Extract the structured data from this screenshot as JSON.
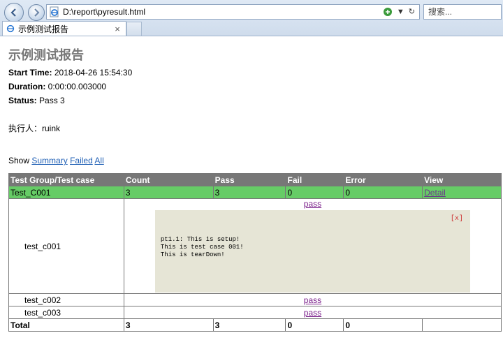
{
  "browser": {
    "address": "D:\\report\\pyresult.html",
    "search_placeholder": "搜索...",
    "tab_title": "示例测试报告",
    "tab_close": "×",
    "addr_dropdown": "▼",
    "addr_refresh": "↻"
  },
  "report": {
    "title": "示例测试报告",
    "start_time_label": "Start Time:",
    "start_time_value": "2018-04-26 15:54:30",
    "duration_label": "Duration:",
    "duration_value": "0:00:00.003000",
    "status_label": "Status:",
    "status_value": "Pass 3",
    "executor": "执行人：ruink",
    "show_label": "Show",
    "filter_summary": "Summary",
    "filter_failed": "Failed",
    "filter_all": "All"
  },
  "table": {
    "headers": [
      "Test Group/Test case",
      "Count",
      "Pass",
      "Fail",
      "Error",
      "View"
    ],
    "group": {
      "name": "Test_C001",
      "count": "3",
      "pass": "3",
      "fail": "0",
      "error": "0",
      "view": "Detail"
    },
    "cases": [
      {
        "name": "test_c001",
        "result": "pass",
        "output_close": "[x]",
        "output": "pt1.1: This is setup!\nThis is test case 001!\nThis is tearDown!"
      },
      {
        "name": "test_c002",
        "result": "pass"
      },
      {
        "name": "test_c003",
        "result": "pass"
      }
    ],
    "total": {
      "label": "Total",
      "count": "3",
      "pass": "3",
      "fail": "0",
      "error": "0"
    }
  },
  "colors": {
    "header_bg": "#777777",
    "group_bg": "#66cc66",
    "popup_bg": "#e6e5d6",
    "link": "#1f5fb5"
  }
}
